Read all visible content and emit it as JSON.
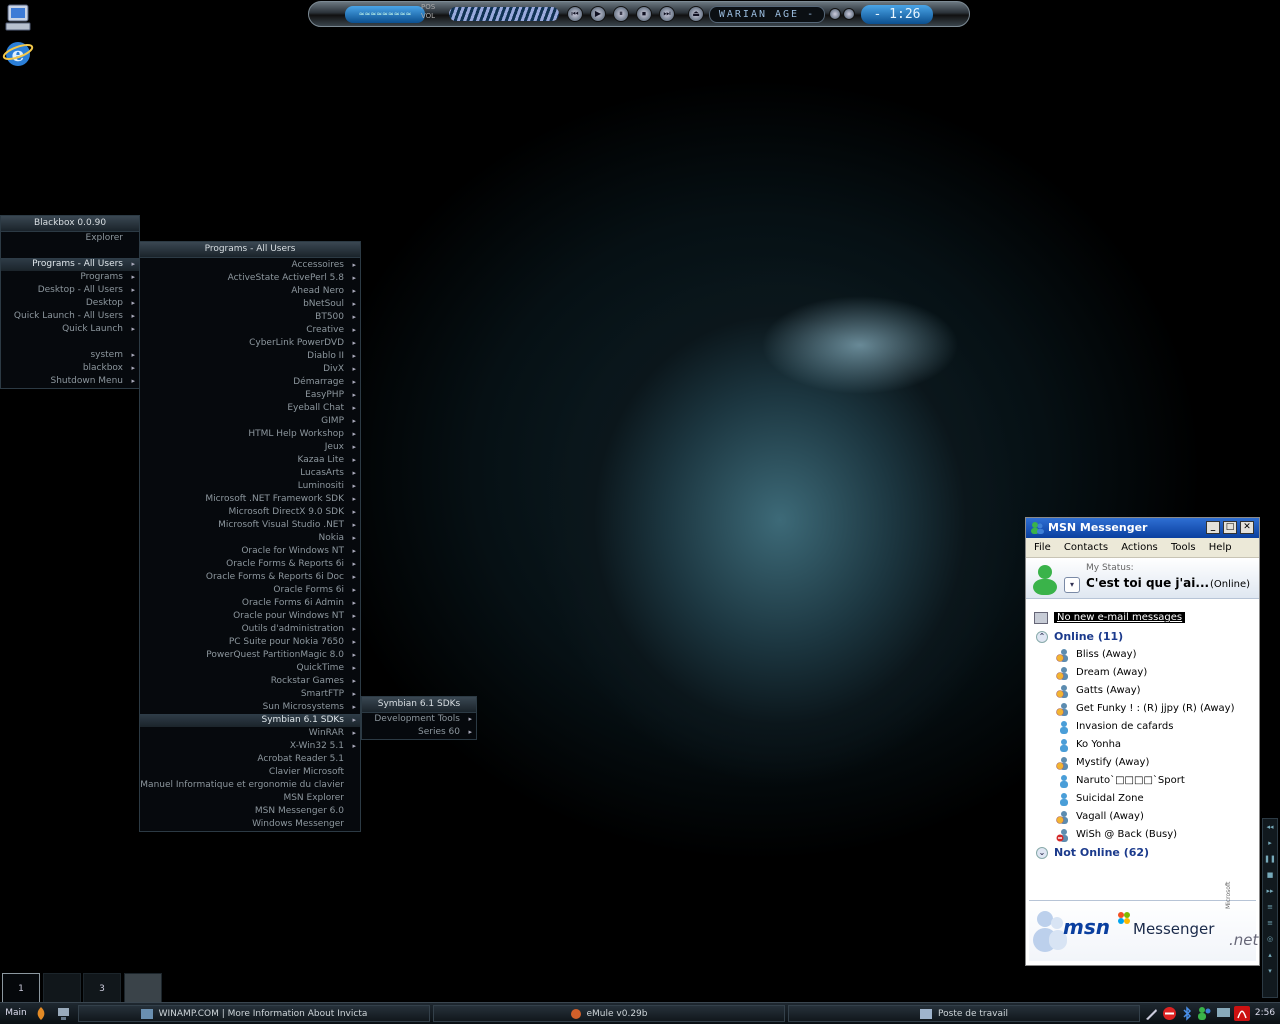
{
  "winamp": {
    "vis_label": "≈≈≈≈≈≈≈≈≈",
    "pos_label": "POS",
    "vol_label": "VOL",
    "controls": [
      "⏮",
      "▶",
      "⏸",
      "⏹",
      "⏭"
    ],
    "eject": "⏏",
    "skin_title": "WARIAN AGE -",
    "time": "- 1:26"
  },
  "root_menu": {
    "title": "Blackbox 0.0.90",
    "items": [
      {
        "label": "Explorer",
        "submenu": false
      },
      {
        "label": "",
        "spacer": true
      },
      {
        "label": "Programs - All Users",
        "submenu": true,
        "selected": true
      },
      {
        "label": "Programs",
        "submenu": true
      },
      {
        "label": "Desktop - All Users",
        "submenu": true
      },
      {
        "label": "Desktop",
        "submenu": true
      },
      {
        "label": "Quick Launch - All Users",
        "submenu": true
      },
      {
        "label": "Quick Launch",
        "submenu": true
      },
      {
        "label": "",
        "spacer": true
      },
      {
        "label": "system",
        "submenu": true
      },
      {
        "label": "blackbox",
        "submenu": true
      },
      {
        "label": "Shutdown Menu",
        "submenu": true
      }
    ]
  },
  "programs_menu": {
    "title": "Programs - All Users",
    "items": [
      {
        "label": "Accessoires",
        "submenu": true
      },
      {
        "label": "ActiveState ActivePerl 5.8",
        "submenu": true
      },
      {
        "label": "Ahead Nero",
        "submenu": true
      },
      {
        "label": "bNetSoul",
        "submenu": true
      },
      {
        "label": "BT500",
        "submenu": true
      },
      {
        "label": "Creative",
        "submenu": true
      },
      {
        "label": "CyberLink PowerDVD",
        "submenu": true
      },
      {
        "label": "Diablo II",
        "submenu": true
      },
      {
        "label": "DivX",
        "submenu": true
      },
      {
        "label": "Démarrage",
        "submenu": true
      },
      {
        "label": "EasyPHP",
        "submenu": true
      },
      {
        "label": "Eyeball Chat",
        "submenu": true
      },
      {
        "label": "GIMP",
        "submenu": true
      },
      {
        "label": "HTML Help Workshop",
        "submenu": true
      },
      {
        "label": "Jeux",
        "submenu": true
      },
      {
        "label": "Kazaa Lite",
        "submenu": true
      },
      {
        "label": "LucasArts",
        "submenu": true
      },
      {
        "label": "Luminositi",
        "submenu": true
      },
      {
        "label": "Microsoft .NET Framework SDK",
        "submenu": true
      },
      {
        "label": "Microsoft DirectX 9.0 SDK",
        "submenu": true
      },
      {
        "label": "Microsoft Visual Studio .NET",
        "submenu": true
      },
      {
        "label": "Nokia",
        "submenu": true
      },
      {
        "label": "Oracle for Windows NT",
        "submenu": true
      },
      {
        "label": "Oracle Forms & Reports 6i",
        "submenu": true
      },
      {
        "label": "Oracle Forms & Reports 6i Doc",
        "submenu": true
      },
      {
        "label": "Oracle Forms 6i",
        "submenu": true
      },
      {
        "label": "Oracle Forms 6i Admin",
        "submenu": true
      },
      {
        "label": "Oracle pour Windows NT",
        "submenu": true
      },
      {
        "label": "Outils d'administration",
        "submenu": true
      },
      {
        "label": "PC Suite pour Nokia 7650",
        "submenu": true
      },
      {
        "label": "PowerQuest PartitionMagic 8.0",
        "submenu": true
      },
      {
        "label": "QuickTime",
        "submenu": true
      },
      {
        "label": "Rockstar Games",
        "submenu": true
      },
      {
        "label": "SmartFTP",
        "submenu": true
      },
      {
        "label": "Sun Microsystems",
        "submenu": true
      },
      {
        "label": "Symbian 6.1 SDKs",
        "submenu": true,
        "selected": true
      },
      {
        "label": "WinRAR",
        "submenu": true
      },
      {
        "label": "X-Win32 5.1",
        "submenu": true
      },
      {
        "label": "Acrobat Reader 5.1",
        "submenu": false
      },
      {
        "label": "Clavier Microsoft",
        "submenu": false
      },
      {
        "label": "Manuel Informatique et ergonomie du clavier",
        "submenu": false
      },
      {
        "label": "MSN Explorer",
        "submenu": false
      },
      {
        "label": "MSN Messenger 6.0",
        "submenu": false
      },
      {
        "label": "Windows Messenger",
        "submenu": false
      }
    ]
  },
  "symbian_menu": {
    "title": "Symbian 6.1 SDKs",
    "items": [
      {
        "label": "Development Tools",
        "submenu": true
      },
      {
        "label": "Series 60",
        "submenu": true
      }
    ]
  },
  "msn": {
    "title": "MSN Messenger",
    "window_buttons": [
      "_",
      "□",
      "✕"
    ],
    "menu": [
      "File",
      "Contacts",
      "Actions",
      "Tools",
      "Help"
    ],
    "status_label": "My Status:",
    "display_name": "C'est toi que j'ai...",
    "presence": "(Online)",
    "email_notice": "No new e-mail messages",
    "online_group": "Online (11)",
    "contacts": [
      {
        "name": "Bliss (Away)",
        "state": "away"
      },
      {
        "name": "Dream (Away)",
        "state": "away"
      },
      {
        "name": "Gatts (Away)",
        "state": "away"
      },
      {
        "name": "Get Funky ! : (R) jjpy (R) (Away)",
        "state": "away"
      },
      {
        "name": "Invasion de cafards",
        "state": "online"
      },
      {
        "name": "Ko Yonha",
        "state": "online"
      },
      {
        "name": "Mystify (Away)",
        "state": "away"
      },
      {
        "name": "Naruto`□□□□`Sport",
        "state": "online"
      },
      {
        "name": "Suicidal Zone",
        "state": "online"
      },
      {
        "name": "Vagall (Away)",
        "state": "away"
      },
      {
        "name": "WiSh @ Back (Busy)",
        "state": "busy"
      }
    ],
    "offline_group": "Not Online (62)",
    "brand_msn": "msn",
    "brand_messenger": "Messenger",
    "brand_net": ".net",
    "brand_microsoft": "Microsoft"
  },
  "workspaces": [
    {
      "label": "1",
      "active": true
    },
    {
      "label": "",
      "active": false
    },
    {
      "label": "3",
      "active": false
    },
    {
      "label": "",
      "active": false
    }
  ],
  "taskbar": {
    "workspace_name": "Main",
    "tasks": [
      {
        "label": "WINAMP.COM | More Information About Invicta"
      },
      {
        "label": "eMule v0.29b"
      },
      {
        "label": "Poste de travail"
      }
    ],
    "clock": "2:56"
  },
  "side_player_controls": [
    "◂◂",
    "▸",
    "❚❚",
    "■",
    "▸▸",
    "≡",
    "≡",
    "◎",
    "▴",
    "▾"
  ],
  "colors": {
    "menu_bg": "#060a0e",
    "menu_text": "#8d979e",
    "msn_title": "#0a3f9f",
    "msn_group": "#1b3a8c"
  }
}
